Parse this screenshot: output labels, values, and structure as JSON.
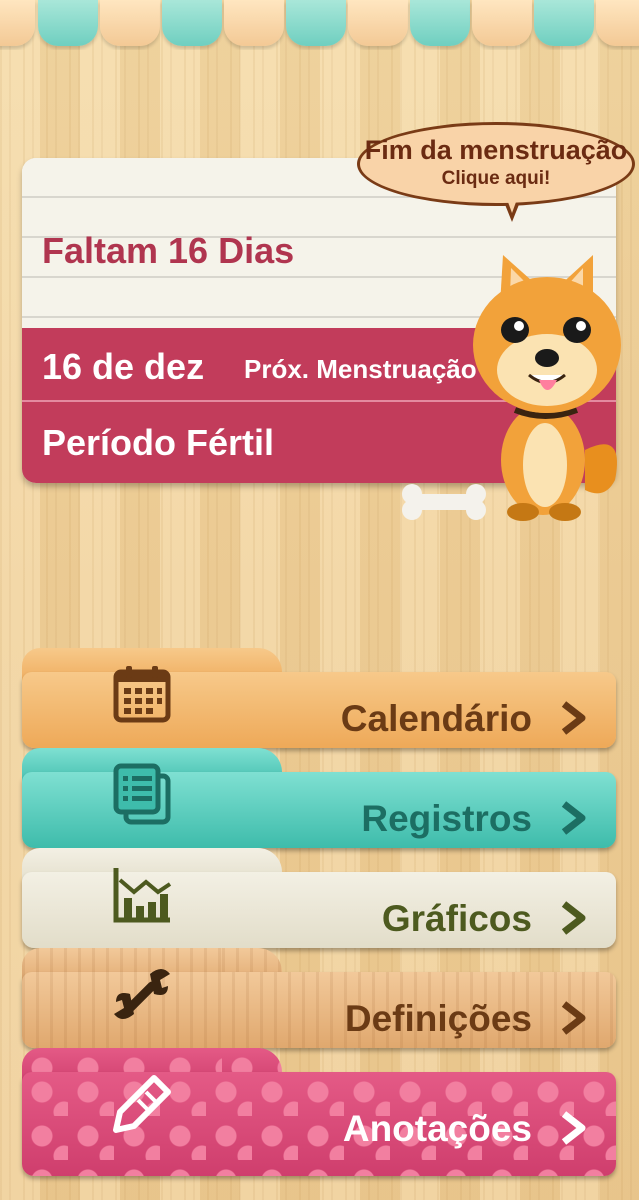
{
  "status": {
    "countdown": "Faltam 16 Dias",
    "next_date": "16 de dez",
    "next_label": "Próx. Menstruação",
    "fertile_label": "Período Fértil"
  },
  "bubble": {
    "title": "Fim da menstruação",
    "subtitle": "Clique aqui!"
  },
  "menu": [
    {
      "label": "Calendário",
      "icon": "calendar-icon"
    },
    {
      "label": "Registros",
      "icon": "records-icon"
    },
    {
      "label": "Gráficos",
      "icon": "chart-icon"
    },
    {
      "label": "Definições",
      "icon": "wrench-icon"
    },
    {
      "label": "Anotações",
      "icon": "pencil-icon"
    }
  ],
  "colors": {
    "accent_pink": "#c23c5b",
    "teal": "#3ebcab",
    "orange": "#eea958",
    "brown_text": "#6b3b15"
  }
}
